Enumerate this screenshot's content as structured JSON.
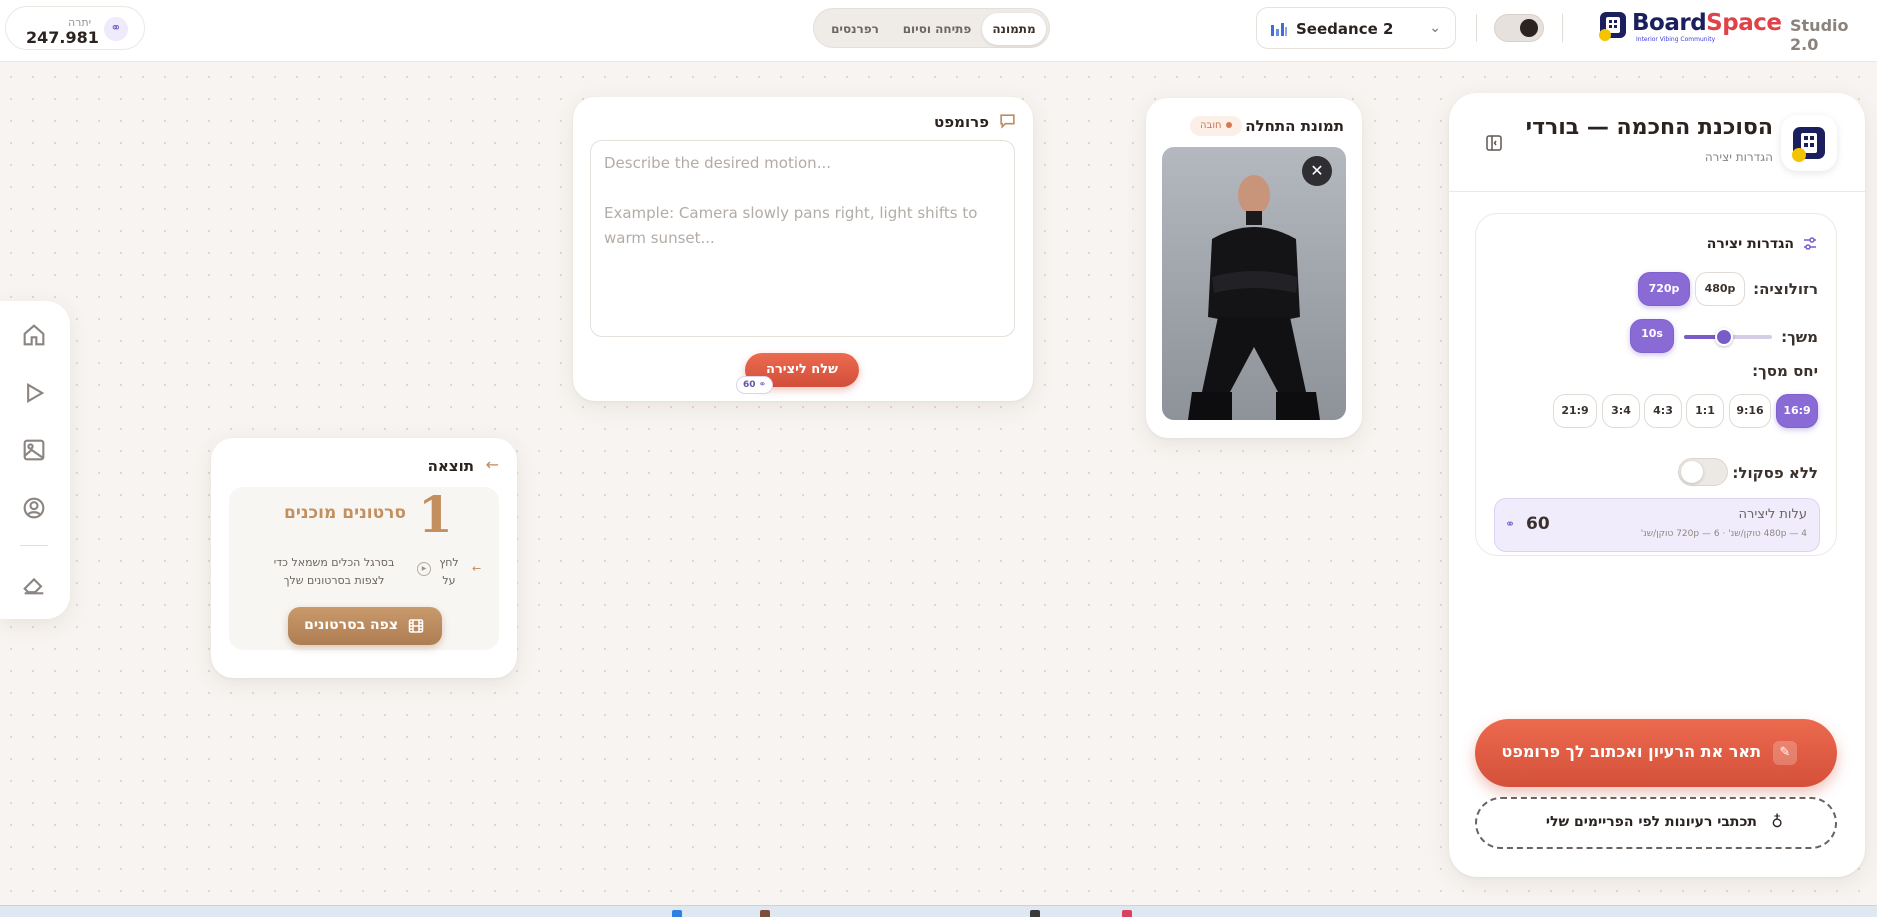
{
  "topbar": {
    "credits_label": "יתרה",
    "credits_value": "247.981",
    "credits_icon": "coins-icon",
    "tabs": [
      {
        "label": "מתמונה",
        "active": true
      },
      {
        "label": "פתיחה וסיום",
        "active": false
      },
      {
        "label": "רפרנסים",
        "active": false
      }
    ],
    "model_name": "Seedance 2",
    "brand_name": "BoardSpace",
    "brand_tagline": "Interior Vibing Community",
    "studio_version": "Studio 2.0"
  },
  "rail": {
    "items": [
      "home-icon",
      "play-icon",
      "image-icon",
      "user-icon",
      "eraser-icon"
    ]
  },
  "panel": {
    "title": "הסוכנת החכמה — בורדי",
    "subtitle": "הגדרות יצירה",
    "settings_title": "הגדרות יצירה",
    "resolution_label": "רזולוציה:",
    "resolution_options": [
      {
        "label": "720p",
        "selected": true
      },
      {
        "label": "480p",
        "selected": false
      }
    ],
    "duration_label": "משך:",
    "duration_value": "10s",
    "duration_fraction": 0.45,
    "aspect_label": "יחס מסך:",
    "aspect_options": [
      {
        "label": "16:9",
        "selected": true
      },
      {
        "label": "9:16",
        "selected": false
      },
      {
        "label": "1:1",
        "selected": false
      },
      {
        "label": "4:3",
        "selected": false
      },
      {
        "label": "3:4",
        "selected": false
      },
      {
        "label": "21:9",
        "selected": false
      }
    ],
    "no_cut_label": "ללא פסקול:",
    "no_cut_on": false,
    "cost_label": "עלות ליצירה",
    "cost_note": "4 — 480p טוקן/שנ' · 6 — 720p טוקן/שנ'",
    "cost_value": "60",
    "cta_primary": "תאר את הרעיון ואכתוב לך פרומפט",
    "cta_secondary": "תכתבי רעיונות לפי הפריימים שלי"
  },
  "start_frame": {
    "title": "תמונת התחלה",
    "badge": "חובה",
    "close": "✕"
  },
  "prompt": {
    "title": "פרומפט",
    "placeholder": "Describe the desired motion...\n\nExample: Camera slowly pans right, light shifts to warm sunset...",
    "value": "",
    "send_label": "שלח ליצירה",
    "send_cost": "60"
  },
  "result": {
    "title": "תוצאה",
    "count": "1",
    "count_label": "סרטונים מוכנים",
    "hint_a": "לחץ על",
    "hint_b": "בסרגל הכלים משמאל כדי לצפות בסרטונים שלך",
    "watch_label": "צפה בסרטונים"
  },
  "colors": {
    "accent_purple": "#8a6bd6",
    "cta_orange": "#e4603f",
    "result_gold": "#c38f5f",
    "background": "#f7f4f1"
  }
}
